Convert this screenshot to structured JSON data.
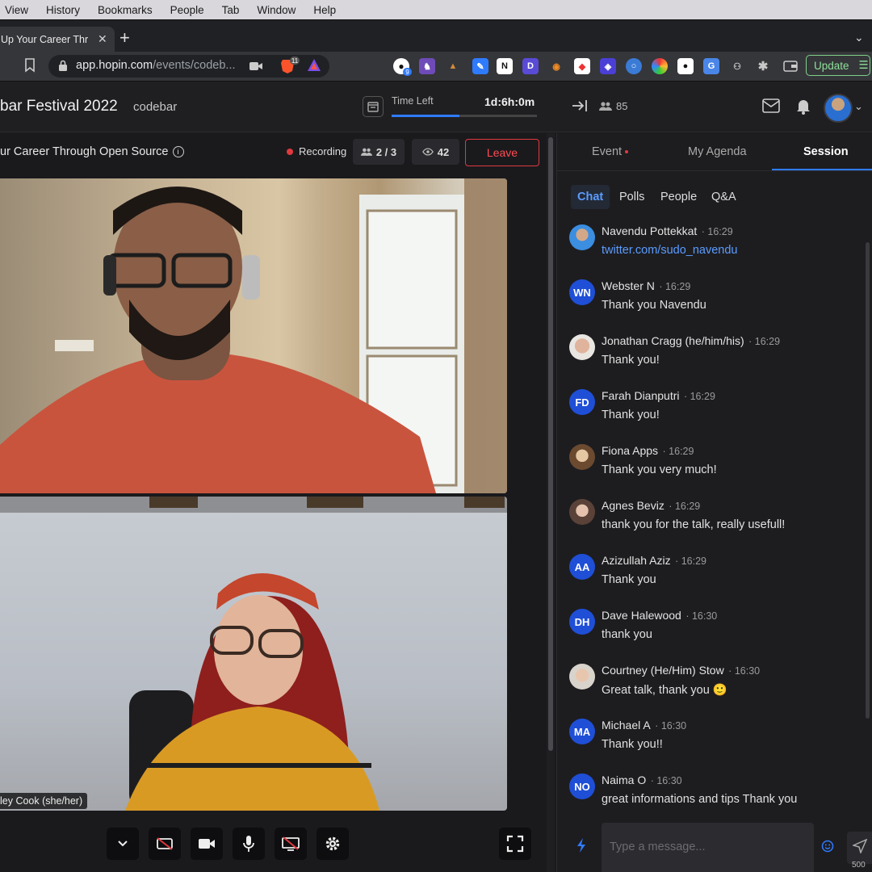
{
  "menubar": [
    "View",
    "History",
    "Bookmarks",
    "People",
    "Tab",
    "Window",
    "Help"
  ],
  "browser": {
    "tab_title": "Up Your Career Thr",
    "url_host": "app.hopin.com",
    "url_path": "/events/codeb...",
    "update_label": "Update",
    "github_badge": "9",
    "brave_badge": "11"
  },
  "header": {
    "event_title": "bar Festival 2022",
    "org": "codebar",
    "time_left_label": "Time Left",
    "time_left_value": "1d:6h:0m",
    "attendees": "85"
  },
  "session": {
    "title": "ur Career Through Open Source",
    "recording": "Recording",
    "participants": "2 / 3",
    "viewers": "42",
    "leave": "Leave",
    "speaker_name": "ley Cook (she/her)"
  },
  "panel": {
    "tabs": [
      "Event",
      "My Agenda",
      "Session"
    ],
    "subtabs": [
      "Chat",
      "Polls",
      "People",
      "Q&A"
    ],
    "placeholder": "Type a message...",
    "char_count": "500"
  },
  "messages": [
    {
      "initials": "",
      "name": "Navendu Pottekkat",
      "time": "16:29",
      "text": "twitter.com/sudo_navendu",
      "link": true
    },
    {
      "initials": "WN",
      "name": "Webster N",
      "time": "16:29",
      "text": "Thank you Navendu"
    },
    {
      "initials": "",
      "name": "Jonathan Cragg (he/him/his)",
      "time": "16:29",
      "text": "Thank you!"
    },
    {
      "initials": "FD",
      "name": "Farah Dianputri",
      "time": "16:29",
      "text": "Thank you!"
    },
    {
      "initials": "",
      "name": "Fiona Apps",
      "time": "16:29",
      "text": "Thank you very much!"
    },
    {
      "initials": "",
      "name": "Agnes Beviz",
      "time": "16:29",
      "text": "thank you for the talk, really usefull!"
    },
    {
      "initials": "AA",
      "name": "Azizullah Aziz",
      "time": "16:29",
      "text": "Thank you"
    },
    {
      "initials": "DH",
      "name": "Dave Halewood",
      "time": "16:30",
      "text": "thank you"
    },
    {
      "initials": "",
      "name": "Courtney (He/Him) Stow",
      "time": "16:30",
      "text": "Great talk, thank you 🙂"
    },
    {
      "initials": "MA",
      "name": "Michael A",
      "time": "16:30",
      "text": "Thank you!!"
    },
    {
      "initials": "NO",
      "name": "Naima O",
      "time": "16:30",
      "text": "great informations and tips Thank you"
    }
  ]
}
